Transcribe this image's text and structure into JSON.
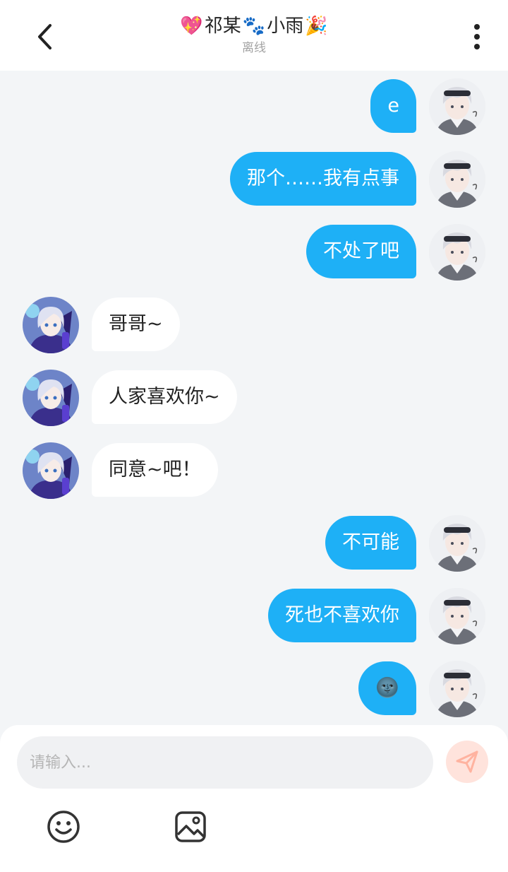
{
  "header": {
    "title_emoji_left": "💖",
    "title_part1": "祁某",
    "title_emoji_mid": "🐾",
    "title_part2": "小雨",
    "title_emoji_right": "🎉",
    "status": "离线"
  },
  "messages": [
    {
      "side": "right",
      "text": "e"
    },
    {
      "side": "right",
      "text": "那个……我有点事"
    },
    {
      "side": "right",
      "text": "不处了吧"
    },
    {
      "side": "left",
      "text": "哥哥~"
    },
    {
      "side": "left",
      "text": "人家喜欢你~"
    },
    {
      "side": "left",
      "text": "同意~吧！"
    },
    {
      "side": "right",
      "text": "不可能"
    },
    {
      "side": "right",
      "text": "死也不喜欢你"
    },
    {
      "side": "right",
      "text": "🌚"
    }
  ],
  "composer": {
    "placeholder": "请输入..."
  },
  "colors": {
    "outgoing_bubble": "#1eb0f6",
    "incoming_bubble": "#ffffff",
    "send_button": "#ffe3dc",
    "send_icon": "#ffb3a0"
  },
  "icons": {
    "back": "back-arrow-icon",
    "more": "more-vertical-icon",
    "send": "send-icon",
    "emoji": "emoji-icon",
    "image": "image-icon"
  }
}
